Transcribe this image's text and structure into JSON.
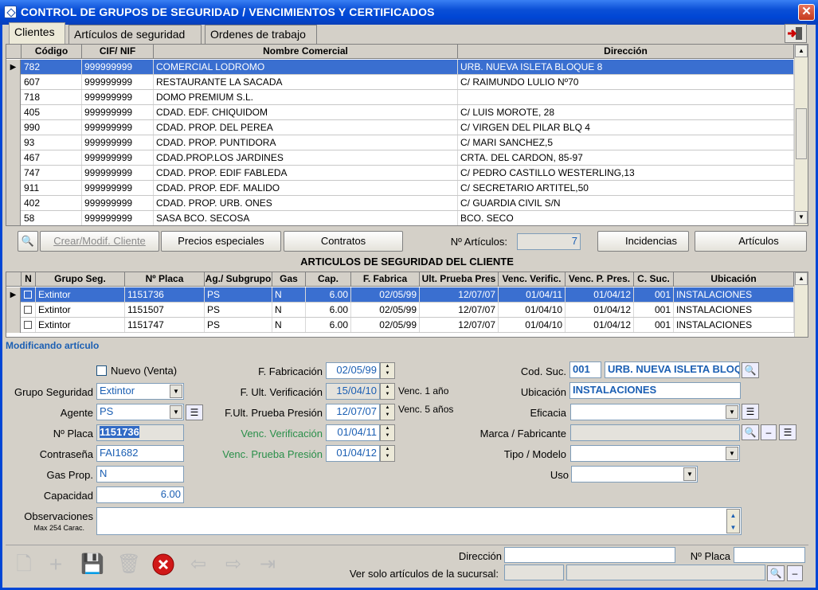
{
  "window": {
    "title": "CONTROL DE GRUPOS DE SEGURIDAD / VENCIMIENTOS Y CERTIFICADOS",
    "close": "✕"
  },
  "tabs": [
    "Clientes",
    "Artículos de seguridad",
    "Ordenes de trabajo"
  ],
  "clients": {
    "headers": [
      "Código",
      "CIF/ NIF",
      "Nombre Comercial",
      "Dirección"
    ],
    "rows": [
      [
        "782",
        "999999999",
        "COMERCIAL LODROMO",
        "URB. NUEVA ISLETA BLOQUE 8"
      ],
      [
        "607",
        "999999999",
        "RESTAURANTE LA SACADA",
        "C/ RAIMUNDO LULIO Nº70"
      ],
      [
        "718",
        "999999999",
        "DOMO PREMIUM  S.L.",
        ""
      ],
      [
        "405",
        "999999999",
        "CDAD. EDF. CHIQUIDOM",
        "C/ LUIS MOROTE, 28"
      ],
      [
        "990",
        "999999999",
        "CDAD. PROP. DEL PEREA",
        "C/ VIRGEN DEL PILAR BLQ 4"
      ],
      [
        "93",
        "999999999",
        "CDAD. PROP. PUNTIDORA",
        "C/ MARI SANCHEZ,5"
      ],
      [
        "467",
        "999999999",
        "CDAD.PROP.LOS JARDINES",
        "CRTA. DEL CARDON, 85-97"
      ],
      [
        "747",
        "999999999",
        "CDAD. PROP. EDIF FABLEDA",
        "C/ PEDRO CASTILLO WESTERLING,13"
      ],
      [
        "911",
        "999999999",
        "CDAD. PROP. EDF. MALIDO",
        "C/ SECRETARIO ARTITEL,50"
      ],
      [
        "402",
        "999999999",
        "CDAD. PROP. URB. ONES",
        "C/ GUARDIA CIVIL S/N"
      ],
      [
        "58",
        "999999999",
        "SASA BCO. SECOSA",
        "BCO. SECO"
      ]
    ]
  },
  "toolbar1": {
    "crear": "Crear/Modif. Cliente",
    "precios": "Precios especiales",
    "contratos": "Contratos",
    "articulos_label": "Nº Artículos:",
    "articulos_value": "7",
    "incidencias": "Incidencias",
    "articulos": "Artículos"
  },
  "section_title": "ARTICULOS DE SEGURIDAD DEL CLIENTE",
  "articles": {
    "headers": [
      "N",
      "Grupo Seg.",
      "Nº Placa",
      "Ag./ Subgrupo",
      "Gas",
      "Cap.",
      "F. Fabrica",
      "Ult. Prueba Pres",
      "Venc. Verific.",
      "Venc. P. Pres.",
      "C. Suc.",
      "Ubicación"
    ],
    "rows": [
      [
        "Extintor",
        "1151736",
        "PS",
        "N",
        "6.00",
        "02/05/99",
        "12/07/07",
        "01/04/11",
        "01/04/12",
        "001",
        "INSTALACIONES"
      ],
      [
        "Extintor",
        "1151507",
        "PS",
        "N",
        "6.00",
        "02/05/99",
        "12/07/07",
        "01/04/10",
        "01/04/12",
        "001",
        "INSTALACIONES"
      ],
      [
        "Extintor",
        "1151747",
        "PS",
        "N",
        "6.00",
        "02/05/99",
        "12/07/07",
        "01/04/10",
        "01/04/12",
        "001",
        "INSTALACIONES"
      ]
    ]
  },
  "form": {
    "mode": "Modificando artículo",
    "nuevo": "Nuevo (Venta)",
    "grupo_label": "Grupo Seguridad",
    "grupo": "Extintor",
    "agente_label": "Agente",
    "agente": "PS",
    "placa_label": "Nº Placa",
    "placa": "1151736",
    "pass_label": "Contraseña",
    "pass": "FAI1682",
    "gas_label": "Gas Prop.",
    "gas": "N",
    "cap_label": "Capacidad",
    "cap": "6.00",
    "obs_label": "Observaciones",
    "obs_sub": "Max 254 Carac.",
    "ffab_label": "F. Fabricación",
    "ffab": "02/05/99",
    "fver_label": "F. Ult. Verificación",
    "fver": "15/04/10",
    "fver_note": "Venc. 1 año",
    "fpp_label": "F.Ult. Prueba Presión",
    "fpp": "12/07/07",
    "fpp_note": "Venc. 5 años",
    "vver_label": "Venc. Verificación",
    "vver": "01/04/11",
    "vpp_label": "Venc. Prueba Presión",
    "vpp": "01/04/12",
    "suc_label": "Cod. Suc.",
    "suc": "001",
    "suc_name": "URB. NUEVA ISLETA BLOQ",
    "ubic_label": "Ubicación",
    "ubic": "INSTALACIONES",
    "efic_label": "Eficacia",
    "marca_label": "Marca / Fabricante",
    "tipo_label": "Tipo / Modelo",
    "uso_label": "Uso"
  },
  "bottom": {
    "dir_label": "Dirección",
    "placa_label": "Nº Placa",
    "suc_label": "Ver solo artículos de la sucursal:"
  }
}
